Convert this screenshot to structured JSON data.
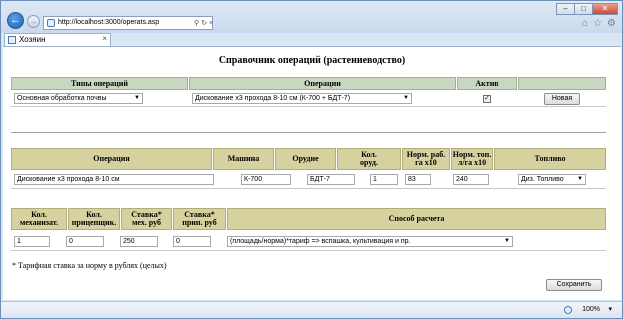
{
  "browser": {
    "url": "http://localhost:3000/operats.asp",
    "tab_title": "Хозяин",
    "zoom": "100%",
    "back_icon": "back-arrow-icon",
    "forward_icon": "forward-arrow-icon"
  },
  "page": {
    "title": "Справочник операций (растениеводство)"
  },
  "top_table": {
    "headers": {
      "op_types": "Типы операций",
      "operations": "Операции",
      "active": "Актив"
    },
    "op_type_value": "Основная обработка почвы",
    "operation_value": "Дискование х3 прохода 8-10 см  (К-700 + БДТ-7)",
    "active_checked": true,
    "new_button": "Новая"
  },
  "detail_table": {
    "headers": {
      "operation": "Операция",
      "machine": "Машина",
      "tool": "Орудие",
      "tool_count": "Кол. оруд.",
      "norm_work": "Норм. раб. га х10",
      "norm_fuel": "Норм. топ. л/га х10",
      "fuel": "Топливо"
    },
    "values": {
      "operation": "Дискование х3 прохода 8-10 см",
      "machine": "К-700",
      "tool": "БДТ-7",
      "tool_count": "1",
      "norm_work": "83",
      "norm_fuel": "240",
      "fuel": "Диз. Топливо"
    }
  },
  "rate_table": {
    "headers": {
      "mech_count": "Кол. механизат.",
      "trailer_count": "Кол. прицепщик.",
      "mech_rate": "Ставка* мех. руб",
      "trailer_rate": "Ставка* прип. руб",
      "calc_method": "Способ расчета"
    },
    "values": {
      "mech_count": "1",
      "trailer_count": "0",
      "mech_rate": "250",
      "trailer_rate": "0",
      "calc_method": "(площадь/норма)*тариф => вспашка, культивация и пр."
    }
  },
  "footnote": "* Тарифная ставка за норму в рублях (целых)",
  "save_button": "Сохранить"
}
